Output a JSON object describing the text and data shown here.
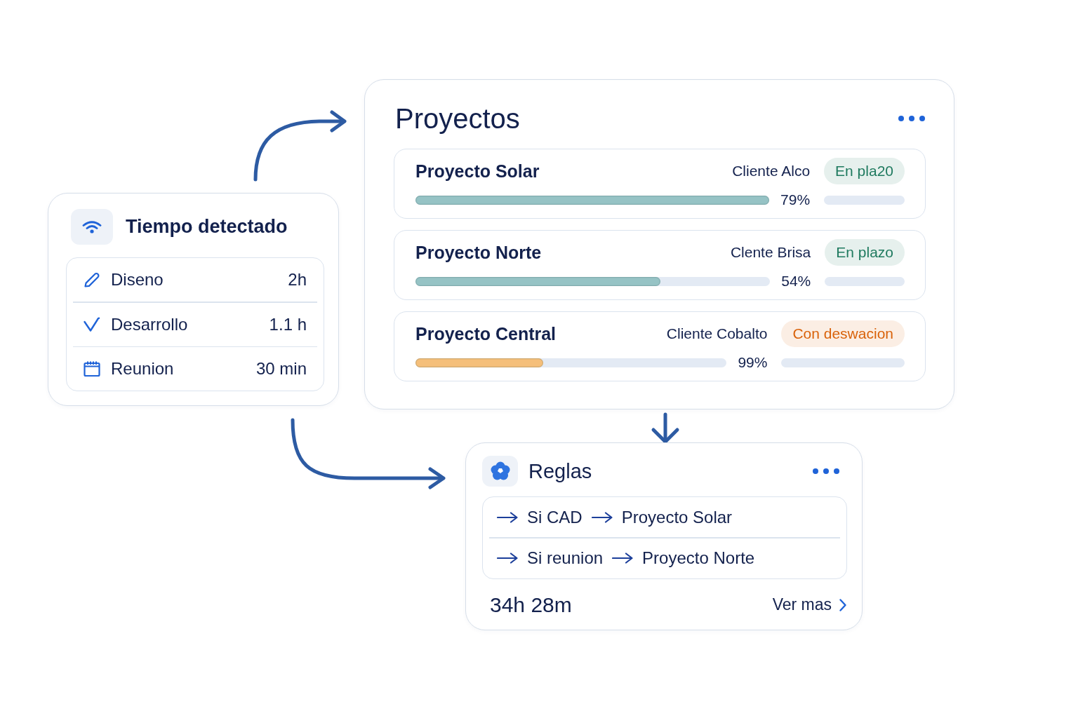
{
  "time_card": {
    "title": "Tiempo detectado",
    "entries": [
      {
        "label": "Diseno",
        "value": "2h"
      },
      {
        "label": "Desarrollo",
        "value": "1.1 h"
      },
      {
        "label": "Reunion",
        "value": "30 min"
      }
    ]
  },
  "projects": {
    "title": "Proyectos",
    "items": [
      {
        "name": "Proyecto Solar",
        "client": "Cliente Alco",
        "status": {
          "label": "En pla20",
          "color": "#1f7a5f"
        },
        "progress": {
          "level": 1.0,
          "color": "#96c3c5"
        },
        "reading": "79%"
      },
      {
        "name": "Proyecto Norte",
        "client": "Clente Brisa",
        "status": {
          "label": "En plazo",
          "color": "#1f7a5f"
        },
        "progress": {
          "level": 0.69,
          "color": "#96c3c5"
        },
        "reading": "54%"
      },
      {
        "name": "Proyecto Central",
        "client": "Cliente Cobalto",
        "status": {
          "label": "Con deswacion",
          "color": "#d9620a"
        },
        "progress": {
          "level": 0.41,
          "color": "#f5bf7a"
        },
        "reading": "99%"
      }
    ]
  },
  "rules": {
    "title": "Reglas",
    "items": [
      {
        "condition": "Si CAD",
        "target": "Proyecto Solar"
      },
      {
        "condition": "Si reunion",
        "target": "Proyecto Norte"
      }
    ],
    "total": "34h 28m",
    "link": "Ver mas"
  }
}
